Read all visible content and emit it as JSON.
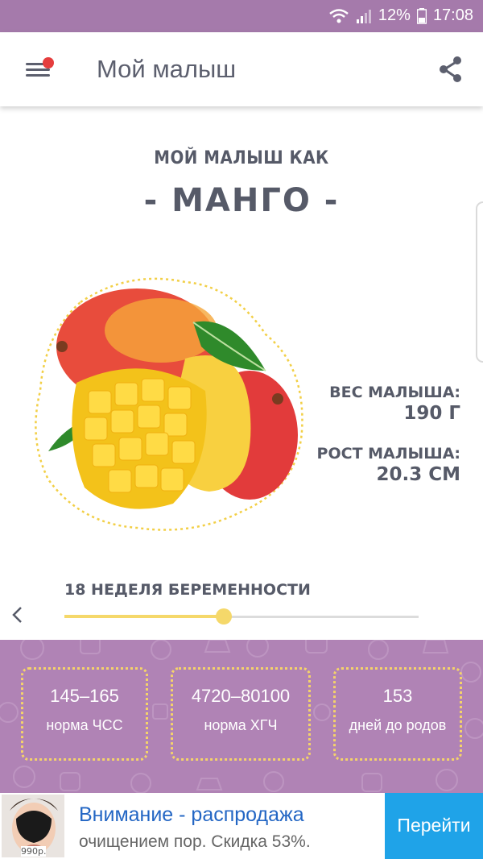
{
  "status_bar": {
    "battery": "12%",
    "time": "17:08"
  },
  "app_bar": {
    "title": "Мой малыш"
  },
  "header": {
    "subtitle": "МОЙ МАЛЫШ КАК",
    "fruit": "- МАНГО -"
  },
  "stats": {
    "weight_label": "ВЕС МАЛЫША:",
    "weight_value": "190 Г",
    "height_label": "РОСТ МАЛЫША:",
    "height_value": "20.3 СМ"
  },
  "week": {
    "label": "18 НЕДЕЛЯ БЕРЕМЕННОСТИ",
    "progress": 0.45
  },
  "info_boxes": [
    {
      "value": "145–165",
      "caption": "норма ЧСС"
    },
    {
      "value": "4720–80100",
      "caption": "норма ХГЧ"
    },
    {
      "value": "153",
      "caption": "дней до родов"
    }
  ],
  "ad": {
    "price": "990р.",
    "title": "Внимание - распродажа",
    "text": "очищением пор. Скидка 53%.",
    "button": "Перейти"
  },
  "colors": {
    "purple": "#b083b5",
    "status_bar": "#a57aab",
    "accent_yellow": "#f5d86a",
    "text_dark": "#565a68",
    "ad_blue": "#1fa3e8"
  },
  "icons": [
    "wifi-icon",
    "signal-icon",
    "battery-icon",
    "menu-icon",
    "notification-dot",
    "share-icon",
    "chevron-left-icon"
  ]
}
